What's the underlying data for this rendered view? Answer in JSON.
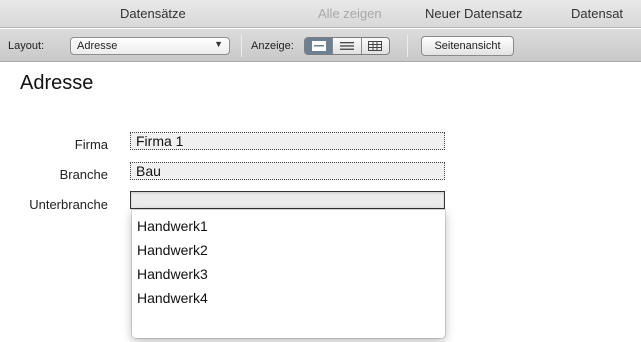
{
  "statusbar": {
    "records": "Datensätze",
    "show_all": "Alle zeigen",
    "new_record": "Neuer Datensatz",
    "delete_record": "Datensat"
  },
  "toolbar": {
    "layout_label": "Layout:",
    "layout_value": "Adresse",
    "view_label": "Anzeige:",
    "view_modes": [
      "form-view-icon",
      "list-view-icon",
      "table-view-icon"
    ],
    "active_view": "form-view-icon",
    "page_view_button": "Seitenansicht"
  },
  "form": {
    "title": "Adresse",
    "fields": [
      {
        "label": "Firma",
        "value": "Firma 1"
      },
      {
        "label": "Branche",
        "value": "Bau"
      },
      {
        "label": "Unterbranche",
        "value": ""
      }
    ]
  },
  "dropdown": {
    "options": [
      "Handwerk1",
      "Handwerk2",
      "Handwerk3",
      "Handwerk4"
    ]
  },
  "colors": {
    "active_segment": "#6d7f92",
    "toolbar_bg": "#d4d4d4"
  }
}
